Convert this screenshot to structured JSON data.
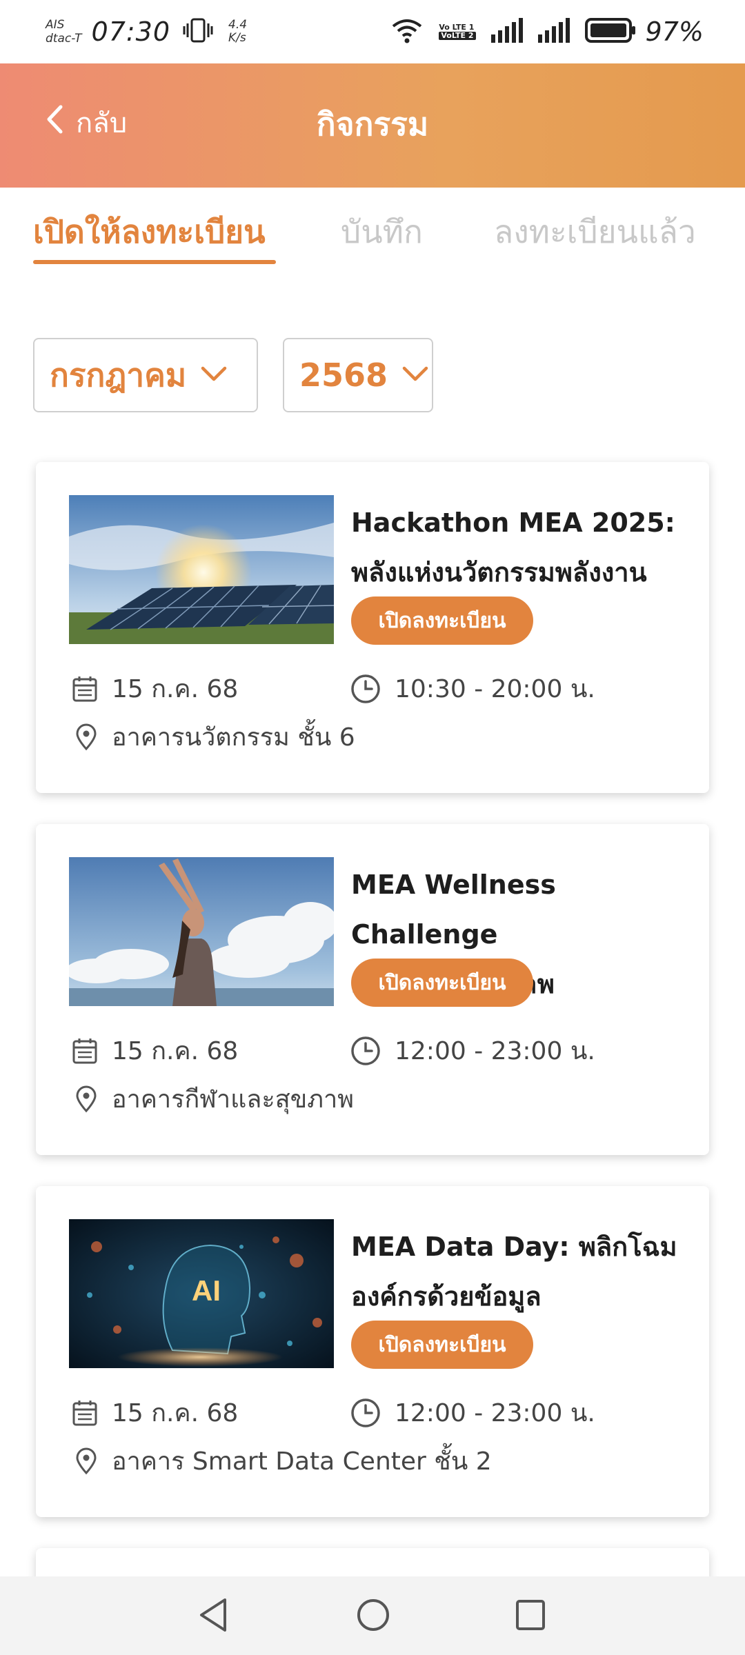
{
  "status_bar": {
    "carrier_1": "AIS",
    "carrier_2": "dtac-T",
    "time": "07:30",
    "speed_value": "4.4",
    "speed_unit": "K/s",
    "volte_top": "Vo LTE 1",
    "volte_bottom": "VoLTE 2",
    "battery": "97%"
  },
  "header": {
    "back_label": "กลับ",
    "title": "กิจกรรม"
  },
  "tabs": [
    {
      "label": "เปิดให้ลงทะเบียน",
      "active": true
    },
    {
      "label": "บันทึก",
      "active": false
    },
    {
      "label": "ลงทะเบียนแล้ว",
      "active": false
    }
  ],
  "filters": {
    "month": "กรกฎาคม",
    "year": "2568"
  },
  "events": [
    {
      "title_line1": "Hackathon MEA 2025:",
      "title_line2": "พลังแห่งนวัตกรรมพลังงาน",
      "badge": "เปิดลงทะเบียน",
      "date": "15 ก.ค. 68",
      "time": "10:30 - 20:00 น.",
      "location": "อาคารนวัตกรรม ชั้น 6",
      "image": "solar-panels-image"
    },
    {
      "title_line1": "MEA Wellness Challenge",
      "title_line2": "30 วันเพื่อสุขภาพ",
      "badge": "เปิดลงทะเบียน",
      "date": "15 ก.ค. 68",
      "time": "12:00 - 23:00 น.",
      "location": "อาคารกีฬาและสุขภาพ",
      "image": "yoga-woman-image"
    },
    {
      "title_line1": "MEA Data Day: พลิกโฉม",
      "title_line2": "องค์กรด้วยข้อมูล",
      "badge": "เปิดลงทะเบียน",
      "date": "15 ก.ค. 68",
      "time": "12:00 - 23:00 น.",
      "location": "อาคาร Smart Data Center ชั้น 2",
      "image": "ai-head-image"
    }
  ],
  "colors": {
    "accent": "#E2843E",
    "header_start": "#EE8B73",
    "header_end": "#E49A4E",
    "inactive_tab": "#C8C8C8"
  }
}
